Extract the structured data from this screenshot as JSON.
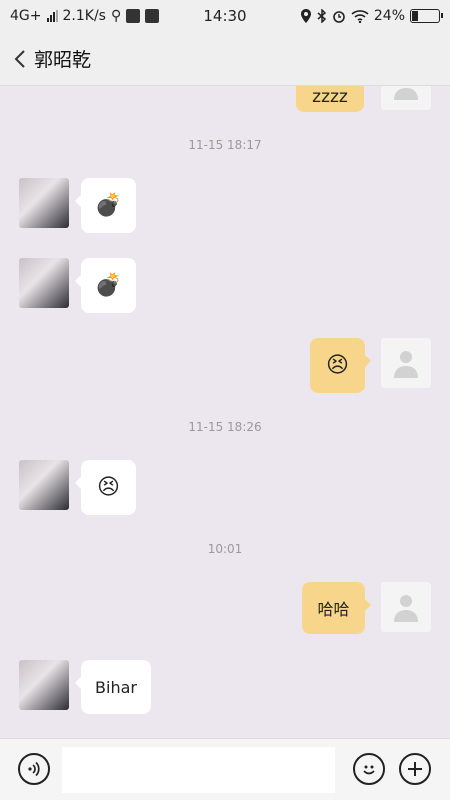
{
  "status_bar": {
    "network": "4G+",
    "speed": "2.1K/s",
    "time": "14:30",
    "battery": "24%",
    "battery_level": 0.24
  },
  "header": {
    "back_icon": "chevron-left-icon",
    "contact_name": "郭昭乾"
  },
  "messages": {
    "m0": {
      "text": "zzzz"
    },
    "t1": "11-15 18:17",
    "m1": {
      "emoji": "💣"
    },
    "m2": {
      "emoji": "💣"
    },
    "m3": {
      "emoji": "😣"
    },
    "t2": "11-15 18:26",
    "m4": {
      "emoji": "😣"
    },
    "t3": "10:01",
    "m5": {
      "text": "哈哈"
    },
    "m6": {
      "text": "Bihar"
    }
  },
  "input_bar": {
    "text_value": "",
    "voice_icon": "voice-icon",
    "emoji_icon": "smiley-icon",
    "add_icon": "plus-icon"
  }
}
